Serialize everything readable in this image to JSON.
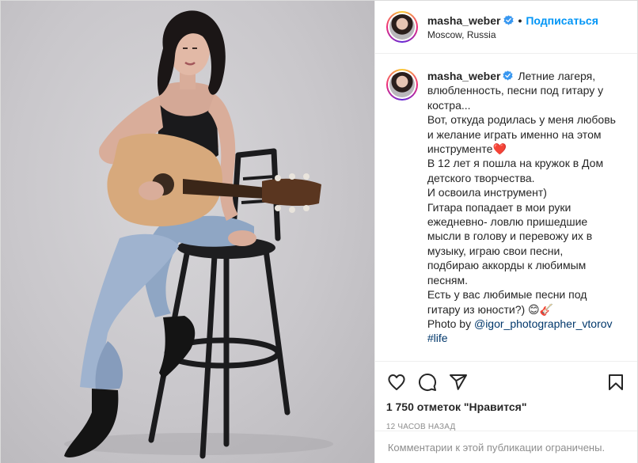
{
  "post": {
    "username": "masha_weber",
    "follow_label": "Подписаться",
    "separator": "•",
    "location": "Moscow, Russia",
    "caption_lines": [
      "Летние лагеря,",
      "влюбленность, песни под гитару у",
      "костра...",
      "Вот, откуда родилась у меня любовь",
      "и желание играть именно на этом",
      "инструменте❤️",
      "В 12 лет я пошла на кружок в Дом",
      "детского творчества.",
      "И освоила инструмент)",
      "Гитара попадает в мои руки",
      "ежедневно- ловлю пришедшие",
      "мысли в голову и перевожу их в",
      "музыку, играю свои песни,",
      "подбираю аккорды к любимым",
      "песням.",
      "Есть у вас любимые песни под",
      "гитару из юности?) 😊🎸"
    ],
    "photo_credit_prefix": "Photo by ",
    "photo_credit_handle": "@igor_photographer_vtorov",
    "hashtag": "#life",
    "likes": "1 750 отметок \"Нравится\"",
    "time_ago": "12 часов назад",
    "comments_disabled": "Комментарии к этой публикации ограничены."
  },
  "icons": {
    "like": "heart-icon",
    "comment": "comment-icon",
    "share": "share-icon",
    "save": "bookmark-icon",
    "verified": "verified-badge-icon"
  },
  "colors": {
    "accent_blue": "#0095f6",
    "link": "#00376b",
    "muted": "#8e8e8e",
    "verified": "#3897f0"
  }
}
